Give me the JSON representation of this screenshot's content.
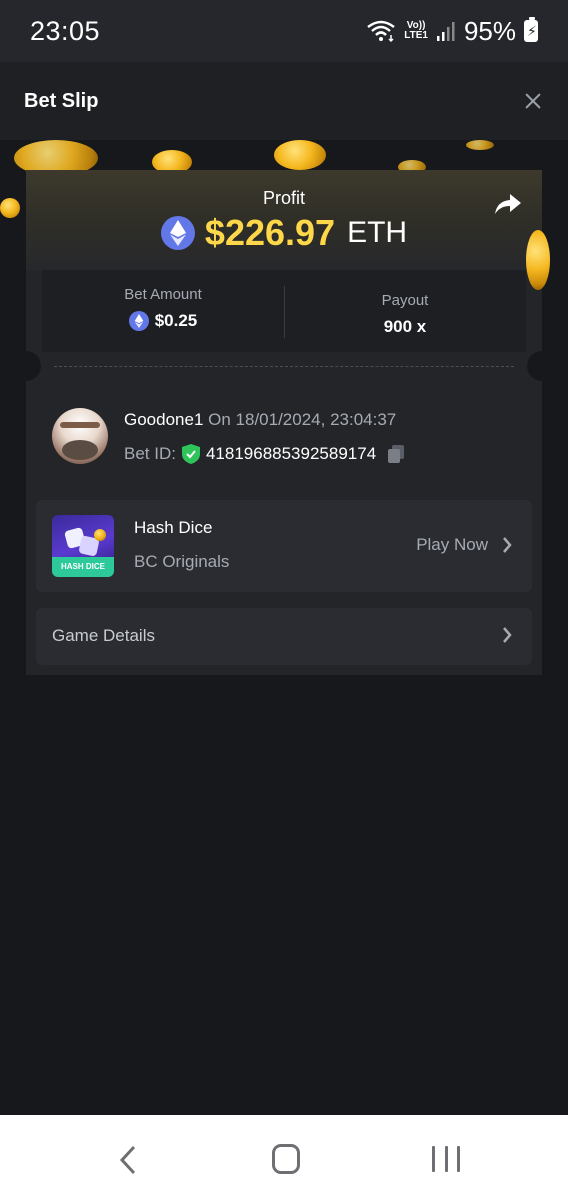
{
  "status_bar": {
    "time": "23:05",
    "network_label_top": "Vo))",
    "network_label_bottom": "LTE1",
    "battery": "95%",
    "icons": [
      "wifi-icon",
      "signal-icon",
      "battery-charging-icon"
    ]
  },
  "header": {
    "title": "Bet Slip",
    "close_icon": "close-icon"
  },
  "profit": {
    "label": "Profit",
    "value": "$226.97",
    "currency": "ETH",
    "icon": "ethereum-icon",
    "share_icon": "share-icon"
  },
  "stats": {
    "bet_amount_label": "Bet Amount",
    "bet_amount_value": "$0.25",
    "payout_label": "Payout",
    "payout_value": "900 x"
  },
  "user": {
    "name": "Goodone1",
    "date_text": "On 18/01/2024, 23:04:37",
    "bet_id_label": "Bet ID:",
    "bet_id_value": "418196885392589174"
  },
  "game": {
    "name": "Hash Dice",
    "provider": "BC Originals",
    "thumb_label": "HASH DICE",
    "play_label": "Play Now"
  },
  "details": {
    "label": "Game Details"
  },
  "colors": {
    "background": "#17181b",
    "card": "#232529",
    "profit_yellow": "#ffd84a",
    "eth_blue": "#6277e8",
    "verified_green": "#2fc45a"
  }
}
